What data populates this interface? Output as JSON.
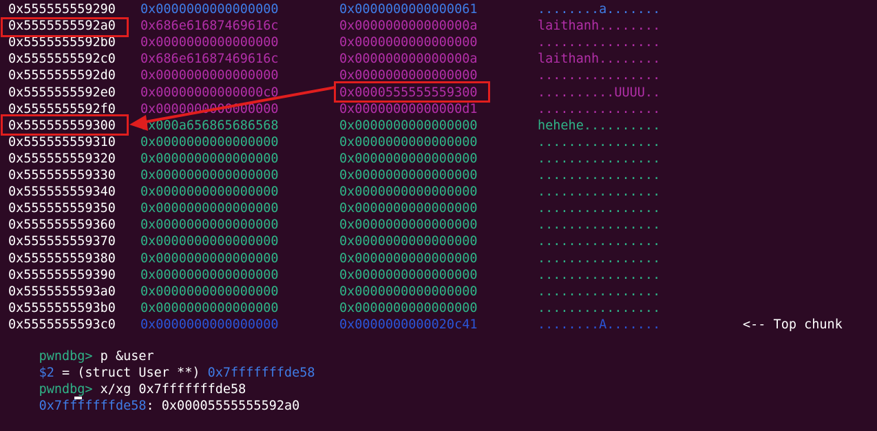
{
  "hexdump": [
    {
      "addr": "0x555555559290",
      "w1": "0x0000000000000000",
      "w2": "0x0000000000000061",
      "ascii": "........a.......",
      "note": "",
      "color": "blue"
    },
    {
      "addr": "0x5555555592a0",
      "w1": "0x686e61687469616c",
      "w2": "0x000000000000000a",
      "ascii": "laithanh........",
      "note": "",
      "color": "purple"
    },
    {
      "addr": "0x5555555592b0",
      "w1": "0x0000000000000000",
      "w2": "0x0000000000000000",
      "ascii": "................",
      "note": "",
      "color": "purple"
    },
    {
      "addr": "0x5555555592c0",
      "w1": "0x686e61687469616c",
      "w2": "0x000000000000000a",
      "ascii": "laithanh........",
      "note": "",
      "color": "purple"
    },
    {
      "addr": "0x5555555592d0",
      "w1": "0x0000000000000000",
      "w2": "0x0000000000000000",
      "ascii": "................",
      "note": "",
      "color": "purple"
    },
    {
      "addr": "0x5555555592e0",
      "w1": "0x00000000000000c0",
      "w2": "0x0000555555559300",
      "ascii": "..........UUUU..",
      "note": "",
      "color": "purple"
    },
    {
      "addr": "0x5555555592f0",
      "w1": "0x0000000000000000",
      "w2": "0x00000000000000d1",
      "ascii": "................",
      "note": "",
      "color": "purple"
    },
    {
      "addr": "0x555555559300",
      "w1": "0x000a656865686568",
      "w2": "0x0000000000000000",
      "ascii": "hehehe..........",
      "note": "",
      "color": "green"
    },
    {
      "addr": "0x555555559310",
      "w1": "0x0000000000000000",
      "w2": "0x0000000000000000",
      "ascii": "................",
      "note": "",
      "color": "green"
    },
    {
      "addr": "0x555555559320",
      "w1": "0x0000000000000000",
      "w2": "0x0000000000000000",
      "ascii": "................",
      "note": "",
      "color": "green"
    },
    {
      "addr": "0x555555559330",
      "w1": "0x0000000000000000",
      "w2": "0x0000000000000000",
      "ascii": "................",
      "note": "",
      "color": "green"
    },
    {
      "addr": "0x555555559340",
      "w1": "0x0000000000000000",
      "w2": "0x0000000000000000",
      "ascii": "................",
      "note": "",
      "color": "green"
    },
    {
      "addr": "0x555555559350",
      "w1": "0x0000000000000000",
      "w2": "0x0000000000000000",
      "ascii": "................",
      "note": "",
      "color": "green"
    },
    {
      "addr": "0x555555559360",
      "w1": "0x0000000000000000",
      "w2": "0x0000000000000000",
      "ascii": "................",
      "note": "",
      "color": "green"
    },
    {
      "addr": "0x555555559370",
      "w1": "0x0000000000000000",
      "w2": "0x0000000000000000",
      "ascii": "................",
      "note": "",
      "color": "green"
    },
    {
      "addr": "0x555555559380",
      "w1": "0x0000000000000000",
      "w2": "0x0000000000000000",
      "ascii": "................",
      "note": "",
      "color": "green"
    },
    {
      "addr": "0x555555559390",
      "w1": "0x0000000000000000",
      "w2": "0x0000000000000000",
      "ascii": "................",
      "note": "",
      "color": "green"
    },
    {
      "addr": "0x5555555593a0",
      "w1": "0x0000000000000000",
      "w2": "0x0000000000000000",
      "ascii": "................",
      "note": "",
      "color": "green"
    },
    {
      "addr": "0x5555555593b0",
      "w1": "0x0000000000000000",
      "w2": "0x0000000000000000",
      "ascii": "................",
      "note": "",
      "color": "green"
    },
    {
      "addr": "0x5555555593c0",
      "w1": "0x0000000000000000",
      "w2": "0x0000000000020c41",
      "ascii": "........A.......",
      "note": "<-- Top chunk",
      "color": "navy"
    }
  ],
  "console": {
    "prompt1": "pwndbg> ",
    "cmd1": "p &user",
    "result_prefix": "$2",
    "result_mid": " = (struct User **) ",
    "result_addr": "0x7fffffffde58",
    "prompt2": "pwndbg> ",
    "cmd2": "x/xg 0x7fffffffde58",
    "mem_addr": "0x7fffffffde58",
    "mem_value": ": 0x00005555555592a0"
  },
  "colors": {
    "background": "#2c0a24",
    "highlight_box": "#e01e1e",
    "purple_chunk": "#b22fa8",
    "green_chunk": "#2fb488",
    "top_chunk": "#2a55d8",
    "blue": "#3f7ce6"
  }
}
